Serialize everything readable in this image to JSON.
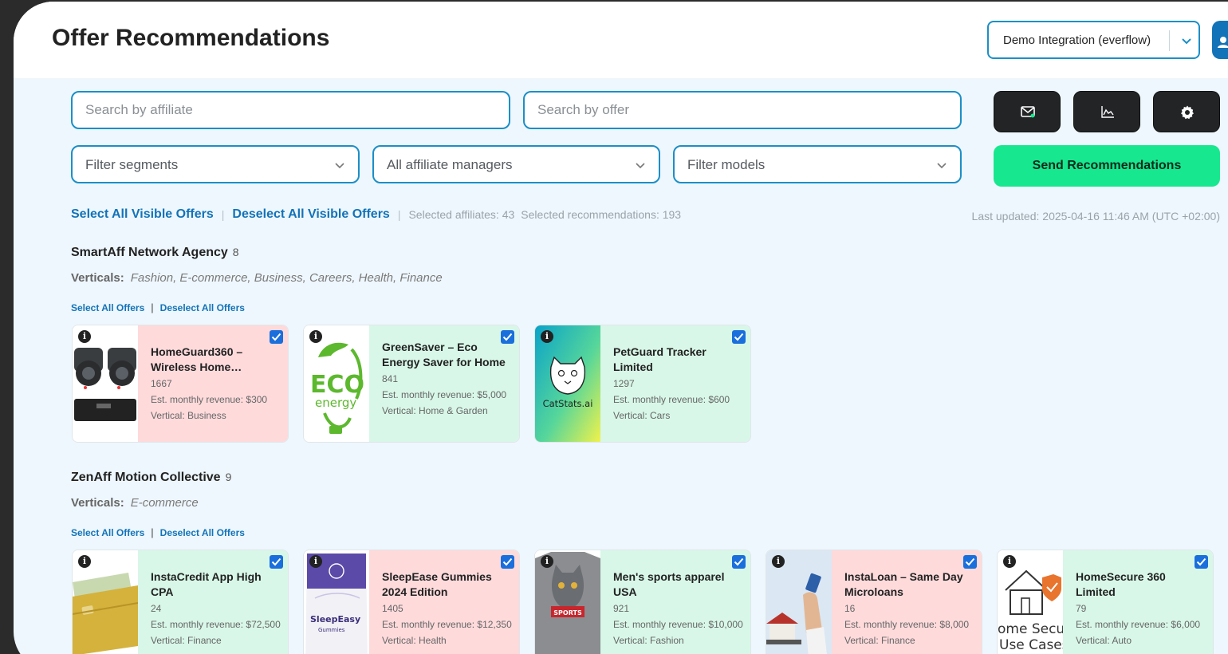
{
  "header": {
    "title": "Offer Recommendations",
    "integration_selected": "Demo Integration (everflow)"
  },
  "filters": {
    "affiliate_placeholder": "Search by affiliate",
    "offer_placeholder": "Search by offer",
    "segments": "Filter segments",
    "managers": "All affiliate managers",
    "models": "Filter models",
    "send_label": "Send Recommendations"
  },
  "toolbar": {
    "select_all": "Select All Visible Offers",
    "deselect_all": "Deselect All Visible Offers",
    "selected_affiliates": "Selected affiliates: 43",
    "selected_recommendations": "Selected recommendations: 193",
    "last_updated": "Last updated: 2025-04-16 11:46 AM (UTC +02:00)"
  },
  "common": {
    "verticals_label": "Verticals:",
    "select_all_offers": "Select All Offers",
    "deselect_all_offers": "Deselect All Offers"
  },
  "agencies": [
    {
      "name": "SmartAff Network Agency",
      "count": "8",
      "verticals": "Fashion,  E-commerce,  Business,  Careers,  Health,  Finance",
      "offers": [
        {
          "name": "HomeGuard360 – Wireless Home…",
          "id": "1667",
          "revenue": "Est. monthly revenue: $300",
          "vertical": "Vertical: Business",
          "tone": "pink",
          "thumb": "camera-image"
        },
        {
          "name": "GreenSaver – Eco Energy Saver for Home",
          "id": "841",
          "revenue": "Est. monthly revenue: $5,000",
          "vertical": "Vertical: Home & Garden",
          "tone": "green",
          "thumb": "eco-energy-logo",
          "thumb_text": [
            "ECO",
            "energy"
          ]
        },
        {
          "name": "PetGuard Tracker Limited",
          "id": "1297",
          "revenue": "Est. monthly revenue: $600",
          "vertical": "Vertical: Cars",
          "tone": "green",
          "thumb": "catstats-logo",
          "thumb_text": [
            "CatStats.ai"
          ]
        }
      ]
    },
    {
      "name": "ZenAff Motion Collective",
      "count": "9",
      "verticals": "E-commerce",
      "offers": [
        {
          "name": "InstaCredit App High CPA",
          "id": "24",
          "revenue": "Est. monthly revenue: $72,500",
          "vertical": "Vertical: Finance",
          "tone": "green",
          "thumb": "credit-card-image"
        },
        {
          "name": "SleepEase Gummies 2024 Edition",
          "id": "1405",
          "revenue": "Est. monthly revenue: $12,350",
          "vertical": "Vertical: Health",
          "tone": "pink",
          "thumb": "gummies-bag-image",
          "thumb_text": [
            "SleepEasy",
            "Gummies"
          ]
        },
        {
          "name": "Men's sports apparel USA",
          "id": "921",
          "revenue": "Est. monthly revenue: $10,000",
          "vertical": "Vertical: Fashion",
          "tone": "green",
          "thumb": "cat-shirt-image",
          "thumb_text": [
            "SPORTS"
          ]
        },
        {
          "name": "InstaLoan – Same Day Microloans",
          "id": "16",
          "revenue": "Est. monthly revenue: $8,000",
          "vertical": "Vertical: Finance",
          "tone": "pink",
          "thumb": "loan-hand-image"
        },
        {
          "name": "HomeSecure 360 Limited",
          "id": "79",
          "revenue": "Est. monthly revenue: $6,000",
          "vertical": "Vertical: Auto",
          "tone": "green",
          "thumb": "home-secure-image",
          "thumb_text": [
            "ome Secur",
            "Use Cases"
          ]
        }
      ]
    }
  ],
  "colors": {
    "accent": "#1b8fc7",
    "link": "#1273b8",
    "send": "#17e88f",
    "card_green": "#d8f7e8",
    "card_pink": "#fedadb",
    "checkbox": "#1a6fdc"
  },
  "icons": [
    "chevron-down-icon",
    "user-icon",
    "mail-icon",
    "chart-icon",
    "gear-icon",
    "info-icon",
    "checkbox-checked-icon"
  ]
}
